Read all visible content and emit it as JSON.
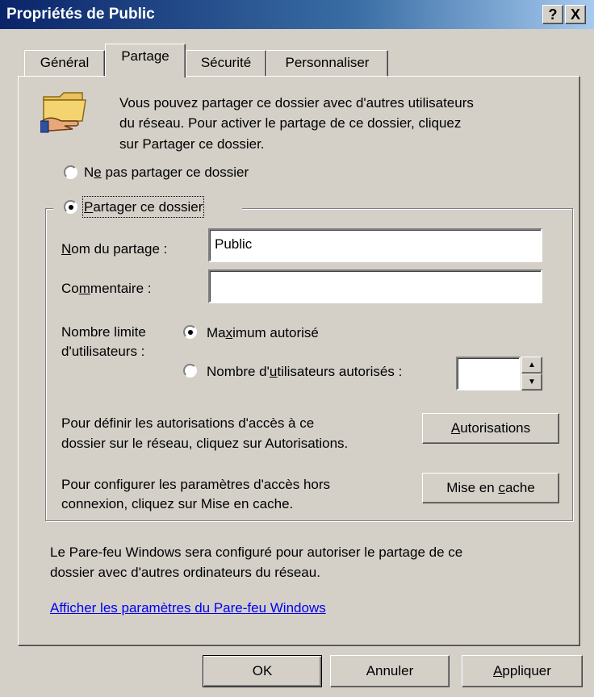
{
  "window": {
    "title": "Propriétés de Public",
    "help_label": "?",
    "close_label": "X"
  },
  "tabs": [
    {
      "label": "Général"
    },
    {
      "label": "Partage"
    },
    {
      "label": "Sécurité"
    },
    {
      "label": "Personnaliser"
    }
  ],
  "intro": {
    "line1": "Vous pouvez partager ce dossier avec d'autres utilisateurs",
    "line2": "du réseau. Pour activer le partage de ce dossier, cliquez",
    "line3": "sur Partager ce dossier."
  },
  "share_mode": {
    "no_share": {
      "pre": "N",
      "accel": "e",
      "post": " pas partager ce dossier",
      "selected": false
    },
    "share": {
      "pre": "",
      "accel": "P",
      "post": "artager ce dossier",
      "selected": true
    }
  },
  "share_name": {
    "label_accel": "N",
    "label_rest": "om du partage :",
    "value": "Public"
  },
  "comment": {
    "label_pre": "Co",
    "label_accel": "m",
    "label_post": "mentaire :",
    "value": ""
  },
  "user_limit": {
    "label_line1": "Nombre limite",
    "label_line2": "d'utilisateurs :",
    "maximum": {
      "pre": "Ma",
      "accel": "x",
      "post": "imum autorisé",
      "selected": true
    },
    "number": {
      "pre": "Nombre d'",
      "accel": "u",
      "post": "tilisateurs autorisés :",
      "selected": false
    },
    "spinner_value": ""
  },
  "permissions": {
    "line1": "Pour définir les autorisations d'accès à ce",
    "line2": "dossier sur le réseau, cliquez sur Autorisations.",
    "button_accel": "A",
    "button_rest": "utorisations"
  },
  "caching": {
    "line1": "Pour configurer les paramètres d'accès hors",
    "line2": "connexion, cliquez sur Mise en cache.",
    "button_pre": "Mise en ",
    "button_accel": "c",
    "button_post": "ache"
  },
  "firewall": {
    "line1": "Le Pare-feu Windows sera configuré pour autoriser le partage de ce",
    "line2": "dossier avec d'autres ordinateurs du réseau.",
    "link": "Afficher les paramètres du Pare-feu Windows"
  },
  "footer": {
    "ok": "OK",
    "cancel": "Annuler",
    "apply_accel": "A",
    "apply_rest": "ppliquer"
  }
}
